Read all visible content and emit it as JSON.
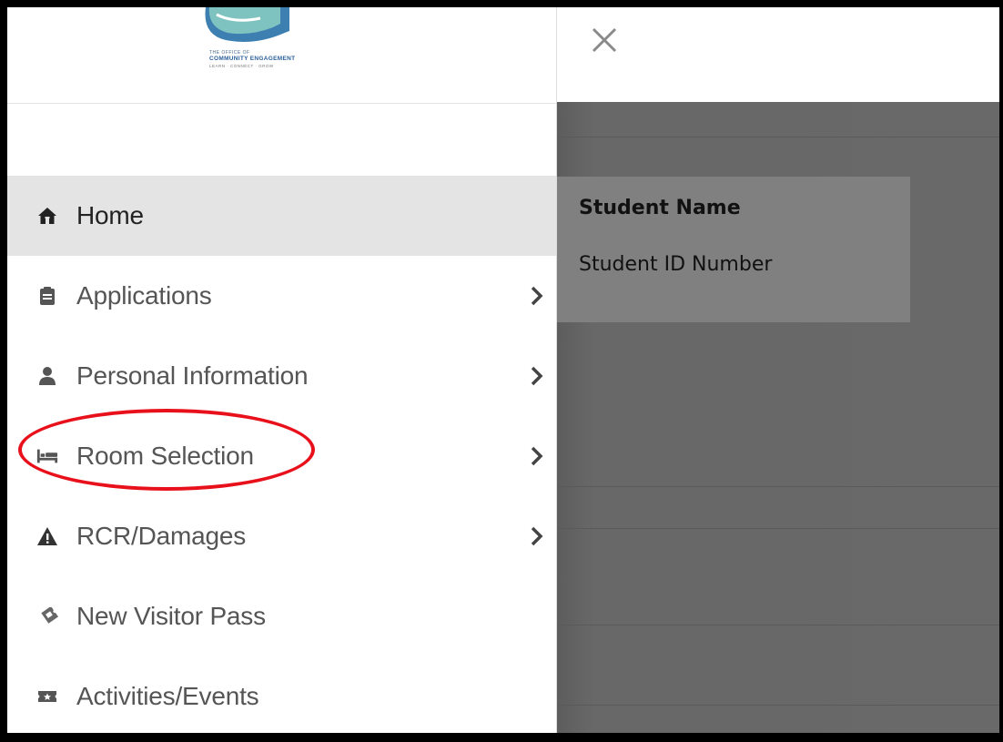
{
  "logo": {
    "line1": "THE OFFICE OF",
    "line2": "COMMUNITY ENGAGEMENT",
    "line3": "LEARN · CONNECT · GROW"
  },
  "sidebar": {
    "items": [
      {
        "label": "Home",
        "icon": "home-icon",
        "active": true,
        "has_submenu": false
      },
      {
        "label": "Applications",
        "icon": "clipboard-icon",
        "active": false,
        "has_submenu": true
      },
      {
        "label": "Personal Information",
        "icon": "user-icon",
        "active": false,
        "has_submenu": true
      },
      {
        "label": "Room Selection",
        "icon": "bed-icon",
        "active": false,
        "has_submenu": true
      },
      {
        "label": "RCR/Damages",
        "icon": "warning-icon",
        "active": false,
        "has_submenu": true
      },
      {
        "label": "New Visitor Pass",
        "icon": "ticket-icon",
        "active": false,
        "has_submenu": false
      },
      {
        "label": "Activities/Events",
        "icon": "ticket-star-icon",
        "active": false,
        "has_submenu": false
      }
    ]
  },
  "student_card": {
    "name_label": "Student Name",
    "id_label": "Student ID Number"
  },
  "colors": {
    "highlight_ring": "#e8101a",
    "active_item_bg": "#e4e4e4",
    "overlay": "#696969"
  }
}
